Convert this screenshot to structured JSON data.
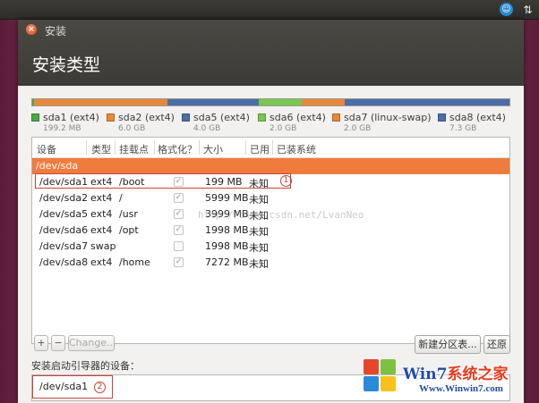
{
  "window": {
    "title": "安装",
    "close_glyph": "×",
    "page_title": "安装类型"
  },
  "topbar": {
    "accessibility_glyph": "☺",
    "network_glyph": "⇅"
  },
  "disk_bar": {
    "segments": [
      {
        "partition": "sda1",
        "color": "#48a848",
        "fraction": 0.004
      },
      {
        "partition": "sda2",
        "color": "#e8883a",
        "fraction": 0.28
      },
      {
        "partition": "sda5",
        "color": "#4c6ea8",
        "fraction": 0.19
      },
      {
        "partition": "sda6",
        "color": "#78c850",
        "fraction": 0.09
      },
      {
        "partition": "sda7",
        "color": "#e8883a",
        "fraction": 0.09
      },
      {
        "partition": "sda8",
        "color": "#4c6ea8",
        "fraction": 0.346
      }
    ]
  },
  "legend": [
    {
      "name": "sda1 (ext4)",
      "size": "199.2 MB",
      "color": "#48a848"
    },
    {
      "name": "sda2 (ext4)",
      "size": "6.0 GB",
      "color": "#e8883a"
    },
    {
      "name": "sda5 (ext4)",
      "size": "4.0 GB",
      "color": "#4c6ea8"
    },
    {
      "name": "sda6 (ext4)",
      "size": "2.0 GB",
      "color": "#78c850"
    },
    {
      "name": "sda7 (linux-swap)",
      "size": "2.0 GB",
      "color": "#e8883a"
    },
    {
      "name": "sda8 (ext4)",
      "size": "7.3 GB",
      "color": "#4c6ea8"
    }
  ],
  "table": {
    "headers": {
      "device": "设备",
      "type": "类型",
      "mount": "挂载点",
      "format": "格式化？",
      "size": "大小",
      "used": "已用",
      "system": "已装系统"
    },
    "group": "/dev/sda",
    "rows": [
      {
        "device": "/dev/sda1",
        "type": "ext4",
        "mount": "/boot",
        "format": true,
        "size": "199 MB",
        "used": "未知"
      },
      {
        "device": "/dev/sda2",
        "type": "ext4",
        "mount": "/",
        "format": true,
        "size": "5999 MB",
        "used": "未知"
      },
      {
        "device": "/dev/sda5",
        "type": "ext4",
        "mount": "/usr",
        "format": true,
        "size": "3999 MB",
        "used": "未知"
      },
      {
        "device": "/dev/sda6",
        "type": "ext4",
        "mount": "/opt",
        "format": true,
        "size": "1998 MB",
        "used": "未知"
      },
      {
        "device": "/dev/sda7",
        "type": "swap",
        "mount": "",
        "format": false,
        "size": "1998 MB",
        "used": "未知"
      },
      {
        "device": "/dev/sda8",
        "type": "ext4",
        "mount": "/home",
        "format": true,
        "size": "7272 MB",
        "used": "未知"
      }
    ],
    "annotation_1": "1",
    "watermark": "http://blog.csdn.net/LvanNeo"
  },
  "toolbar": {
    "add": "+",
    "remove": "−",
    "change": "Change...",
    "new_table": "新建分区表...",
    "revert": "还原"
  },
  "boot": {
    "label": "安装启动引导器的设备：",
    "value": "/dev/sda1",
    "annotation_2": "2"
  },
  "logo": {
    "brand_prefix": "Win7",
    "brand_suffix": "系统之家",
    "url": "Www.Winwin7.com",
    "colors": [
      "#e8462a",
      "#7cc242",
      "#2a8ad8",
      "#f7c21b"
    ]
  }
}
